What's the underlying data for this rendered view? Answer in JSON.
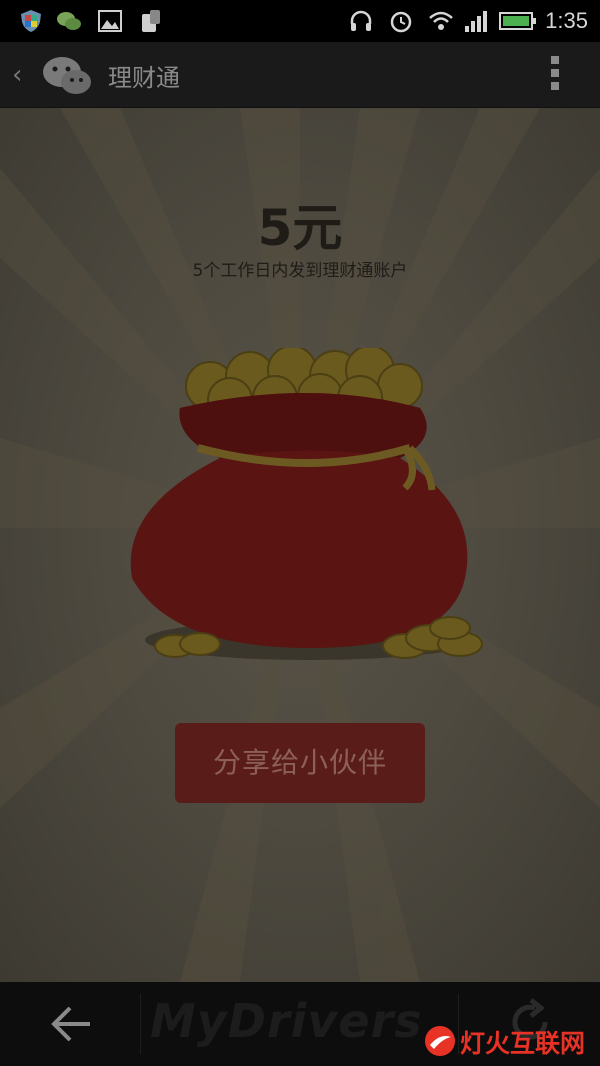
{
  "status_bar": {
    "time": "1:35",
    "icons": [
      "shield-icon",
      "wechat-icon",
      "gallery-icon",
      "notification-icon",
      "headset-icon",
      "alarm-icon",
      "wifi-icon",
      "signal-icon",
      "battery-icon"
    ]
  },
  "action_bar": {
    "title": "理财通",
    "back_icon": "chevron-left-icon",
    "menu_icon": "overflow-menu-icon"
  },
  "reward": {
    "amount": "5元",
    "message": "5个工作日内发到理财通账户"
  },
  "share_button": {
    "label": "分享给小伙伴"
  },
  "nav_bar": {
    "watermark": "MyDrivers",
    "brand": "灯火互联网"
  },
  "colors": {
    "overlay_bg": "#4e4a40",
    "bag_red": "#5a1412",
    "button_bg": "#5a1c18",
    "brand_red": "#e83226"
  }
}
